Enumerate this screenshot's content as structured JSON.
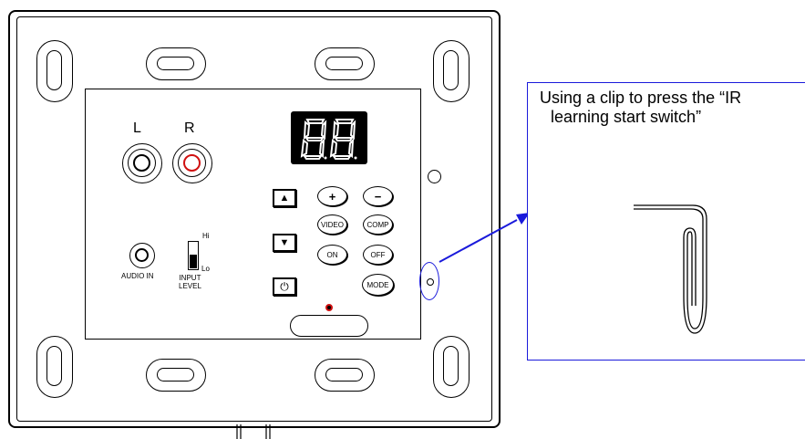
{
  "device": {
    "audio_left_label": "L",
    "audio_right_label": "R",
    "audio_in_label": "AUDIO IN",
    "level_hi_label": "Hi",
    "level_lo_label": "Lo",
    "input_level_label": "INPUT\nLEVEL",
    "buttons": {
      "up_icon": "▲",
      "down_icon": "▼",
      "power_icon": "⏻",
      "plus_label": "+",
      "minus_label": "−",
      "video_label": "VIDEO",
      "comp_label": "COMP",
      "on_label": "ON",
      "off_label": "OFF",
      "mode_label": "MODE"
    },
    "display_value": "88"
  },
  "callout": {
    "text_line1": "Using a clip to press the “IR",
    "text_line2": "learning start switch”"
  },
  "colors": {
    "highlight_blue": "#1a1adb",
    "right_channel_red": "#d01010",
    "led_red": "#d01010"
  }
}
